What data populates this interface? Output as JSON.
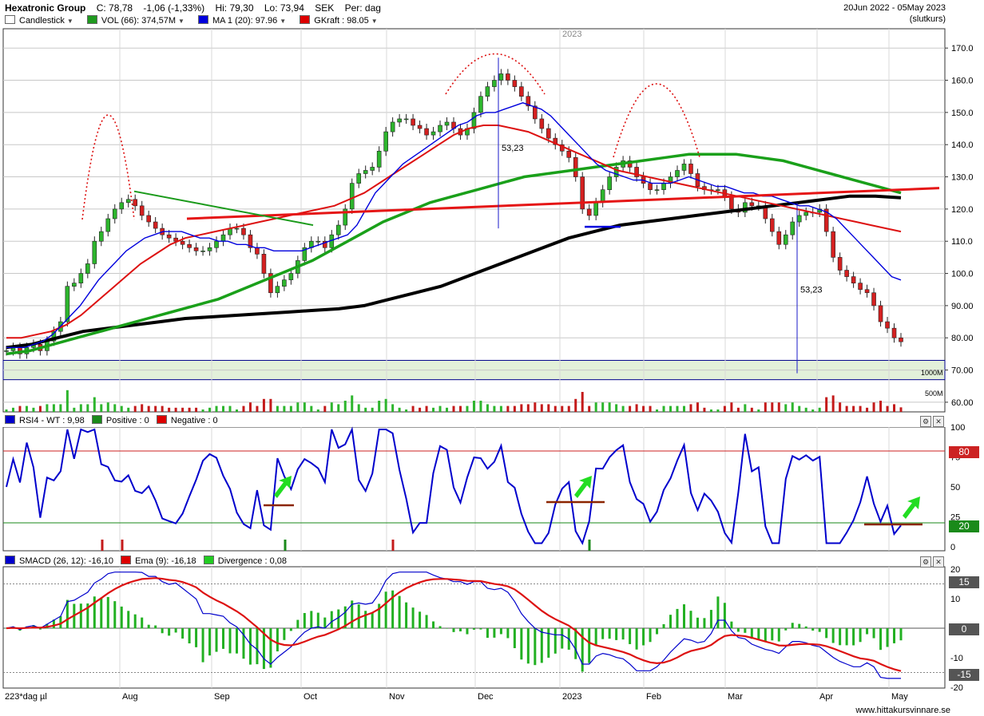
{
  "header": {
    "title": "Hexatronic Group",
    "close": "C: 78,78",
    "change": "-1,06 (-1,33%)",
    "high": "Hi: 79,30",
    "low": "Lo: 73,94",
    "currency": "SEK",
    "period": "Per: dag",
    "date_range": "20Jun 2022 - 05May 2023",
    "price_type": "(slutkurs)"
  },
  "legend": [
    {
      "label": "Candlestick",
      "color": "#ffffff"
    },
    {
      "label": "VOL (66): 374,57M",
      "color": "#1f9a1f"
    },
    {
      "label": "MA 1 (20): 97.96",
      "color": "#0000dd"
    },
    {
      "label": "GKraft : 98.05",
      "color": "#dd0000"
    }
  ],
  "price_panel": {
    "year_label": "2023",
    "volume_ticks": [
      "1000M",
      "500M"
    ],
    "annotations": [
      "53,23",
      "53,23"
    ]
  },
  "rsi_panel": {
    "legend": [
      {
        "label": "RSI4 - WT : 9,98",
        "color": "#0000cc"
      },
      {
        "label": "Positive : 0",
        "color": "#1a8a1a"
      },
      {
        "label": "Negative : 0",
        "color": "#dd0000"
      }
    ],
    "level_high": "80",
    "level_low": "20",
    "high_color": "#cc2222",
    "low_color": "#1a8a1a"
  },
  "macd_panel": {
    "legend": [
      {
        "label": "SMACD (26, 12): -16,10",
        "color": "#0000cc"
      },
      {
        "label": "Ema (9): -16,18",
        "color": "#dd0000"
      },
      {
        "label": "Divergence : 0,08",
        "color": "#22cc22"
      }
    ],
    "level_high": "15",
    "level_zero": "0",
    "level_low": "-15"
  },
  "x_axis": {
    "first_label": "223*dag µl",
    "months": [
      "Aug",
      "Sep",
      "Oct",
      "Nov",
      "Dec",
      "2023",
      "Feb",
      "Mar",
      "Apr",
      "May"
    ]
  },
  "footer": "www.hittakursvinnare.se",
  "chart_data": [
    {
      "type": "line",
      "name": "price",
      "ylim": [
        57,
        176
      ],
      "yticks": [
        "60.00",
        "70.00",
        "80.00",
        "90.00",
        "100.0",
        "110.0",
        "120.0",
        "130.0",
        "140.0",
        "150.0",
        "160.0",
        "170.0"
      ],
      "close": [
        76,
        77,
        75,
        77,
        78,
        76,
        79,
        82,
        85,
        96,
        97,
        100,
        103,
        110,
        113,
        117,
        120,
        122,
        123,
        121,
        118,
        116,
        114,
        112,
        111,
        110,
        109,
        108,
        107,
        107,
        108,
        110,
        112,
        114,
        114,
        112,
        108,
        106,
        100,
        94,
        96,
        98,
        100,
        104,
        108,
        110,
        110,
        108,
        112,
        115,
        120,
        128,
        131,
        132,
        133,
        138,
        144,
        147,
        148,
        148,
        146,
        145,
        143,
        144,
        146,
        147,
        145,
        143,
        145,
        150,
        155,
        158,
        160,
        162,
        160,
        158,
        155,
        152,
        148,
        145,
        142,
        140,
        138,
        136,
        130,
        120,
        118,
        122,
        126,
        130,
        133,
        135,
        133,
        130,
        128,
        126,
        126,
        128,
        130,
        132,
        134,
        131,
        127,
        126,
        126,
        126,
        124,
        120,
        119,
        122,
        121,
        121,
        117,
        113,
        109,
        112,
        116,
        118,
        119,
        119,
        120,
        113,
        105,
        101,
        99,
        97,
        95,
        94,
        90,
        85,
        83,
        80,
        78.78
      ],
      "ma20": [
        77,
        77,
        77,
        78,
        79,
        81,
        84,
        87,
        90,
        94,
        98,
        101,
        104,
        107,
        109,
        111,
        112,
        113,
        113,
        113,
        112,
        111,
        111,
        110,
        110,
        109,
        109,
        108,
        108,
        107,
        107,
        107,
        107,
        108,
        109,
        110,
        111,
        112,
        115,
        120,
        125,
        128,
        131,
        134,
        136,
        138,
        140,
        142,
        144,
        146,
        147,
        149,
        150,
        150,
        151,
        152,
        153,
        152,
        151,
        149,
        146,
        143,
        140,
        137,
        134,
        132,
        131,
        130,
        129,
        129,
        128,
        128,
        128,
        129,
        130,
        129,
        128,
        127,
        127,
        126,
        125,
        125,
        124,
        124,
        123,
        122,
        121,
        121,
        120,
        119,
        117,
        114,
        111,
        108,
        105,
        102,
        99,
        97.96
      ],
      "gkraft": [
        80,
        80,
        81,
        82,
        84,
        87,
        91,
        95,
        99,
        103,
        106,
        109,
        111,
        112,
        113,
        114,
        115,
        116,
        117,
        118,
        119,
        120,
        121,
        123,
        125,
        128,
        131,
        134,
        137,
        140,
        143,
        145,
        146,
        146,
        145,
        144,
        142,
        140,
        138,
        136,
        134,
        132,
        131,
        130,
        129,
        128,
        127,
        126,
        125,
        124,
        123,
        122,
        121,
        120,
        119,
        118,
        117,
        116,
        115,
        114,
        113
      ],
      "ma_long": [
        75,
        76,
        78,
        80,
        82,
        84,
        86,
        88,
        90,
        92,
        95,
        98,
        101,
        104,
        108,
        112,
        116,
        119,
        122,
        124,
        126,
        128,
        130,
        131,
        132,
        133,
        134,
        135,
        136,
        137,
        137,
        137,
        136,
        135,
        133,
        131,
        129,
        127,
        125
      ],
      "ma200": [
        77,
        78,
        80,
        82,
        83,
        84,
        85,
        86,
        86.5,
        87,
        87.5,
        88,
        88.5,
        89,
        90,
        92,
        94,
        96,
        99,
        102,
        105,
        108,
        111,
        113,
        115,
        116,
        117,
        118,
        119,
        120,
        121,
        122,
        123,
        124,
        124,
        123.5
      ]
    }
  ]
}
